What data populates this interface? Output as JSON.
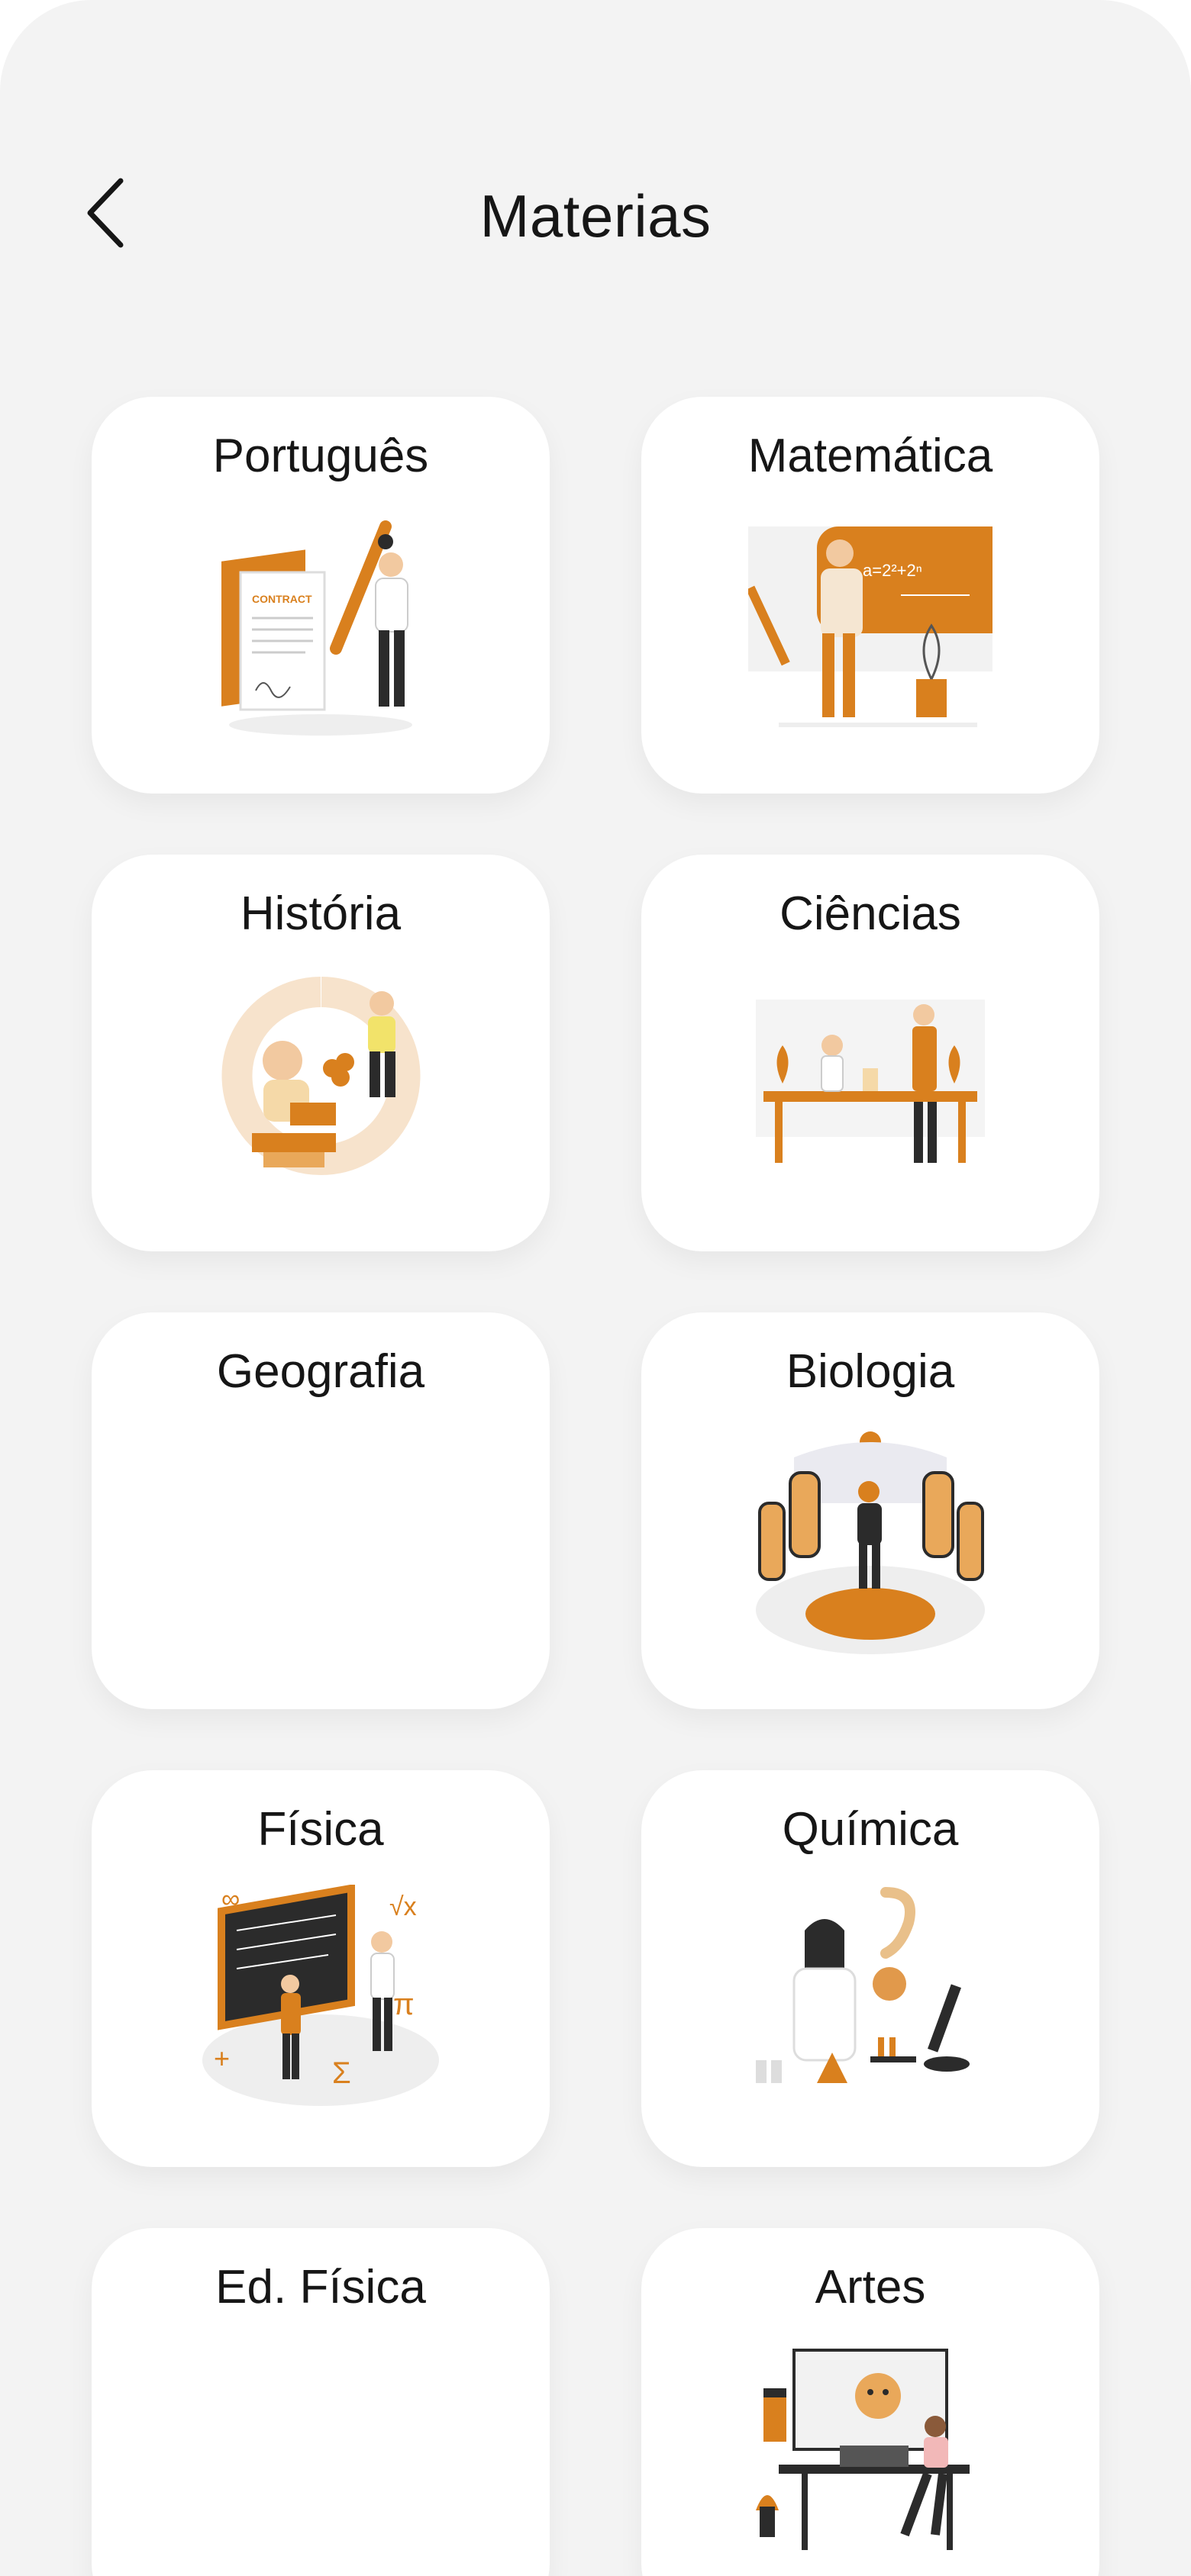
{
  "header": {
    "title": "Materias",
    "back_icon": "chevron-left-icon"
  },
  "colors": {
    "accent": "#D9801E",
    "dark": "#2B2B2B",
    "background": "#F3F3F3",
    "card": "#FFFFFF"
  },
  "subjects": [
    {
      "label": "Português",
      "illustration": "contract-writer-illustration"
    },
    {
      "label": "Matemática",
      "illustration": "math-teacher-illustration"
    },
    {
      "label": "História",
      "illustration": "history-illustration"
    },
    {
      "label": "Ciências",
      "illustration": "science-lab-illustration"
    },
    {
      "label": "Geografia",
      "illustration": ""
    },
    {
      "label": "Biologia",
      "illustration": "biology-illustration"
    },
    {
      "label": "Física",
      "illustration": "physics-blackboard-illustration"
    },
    {
      "label": "Química",
      "illustration": "chemistry-illustration"
    },
    {
      "label": "Ed. Física",
      "illustration": ""
    },
    {
      "label": "Artes",
      "illustration": "art-designer-illustration"
    }
  ]
}
